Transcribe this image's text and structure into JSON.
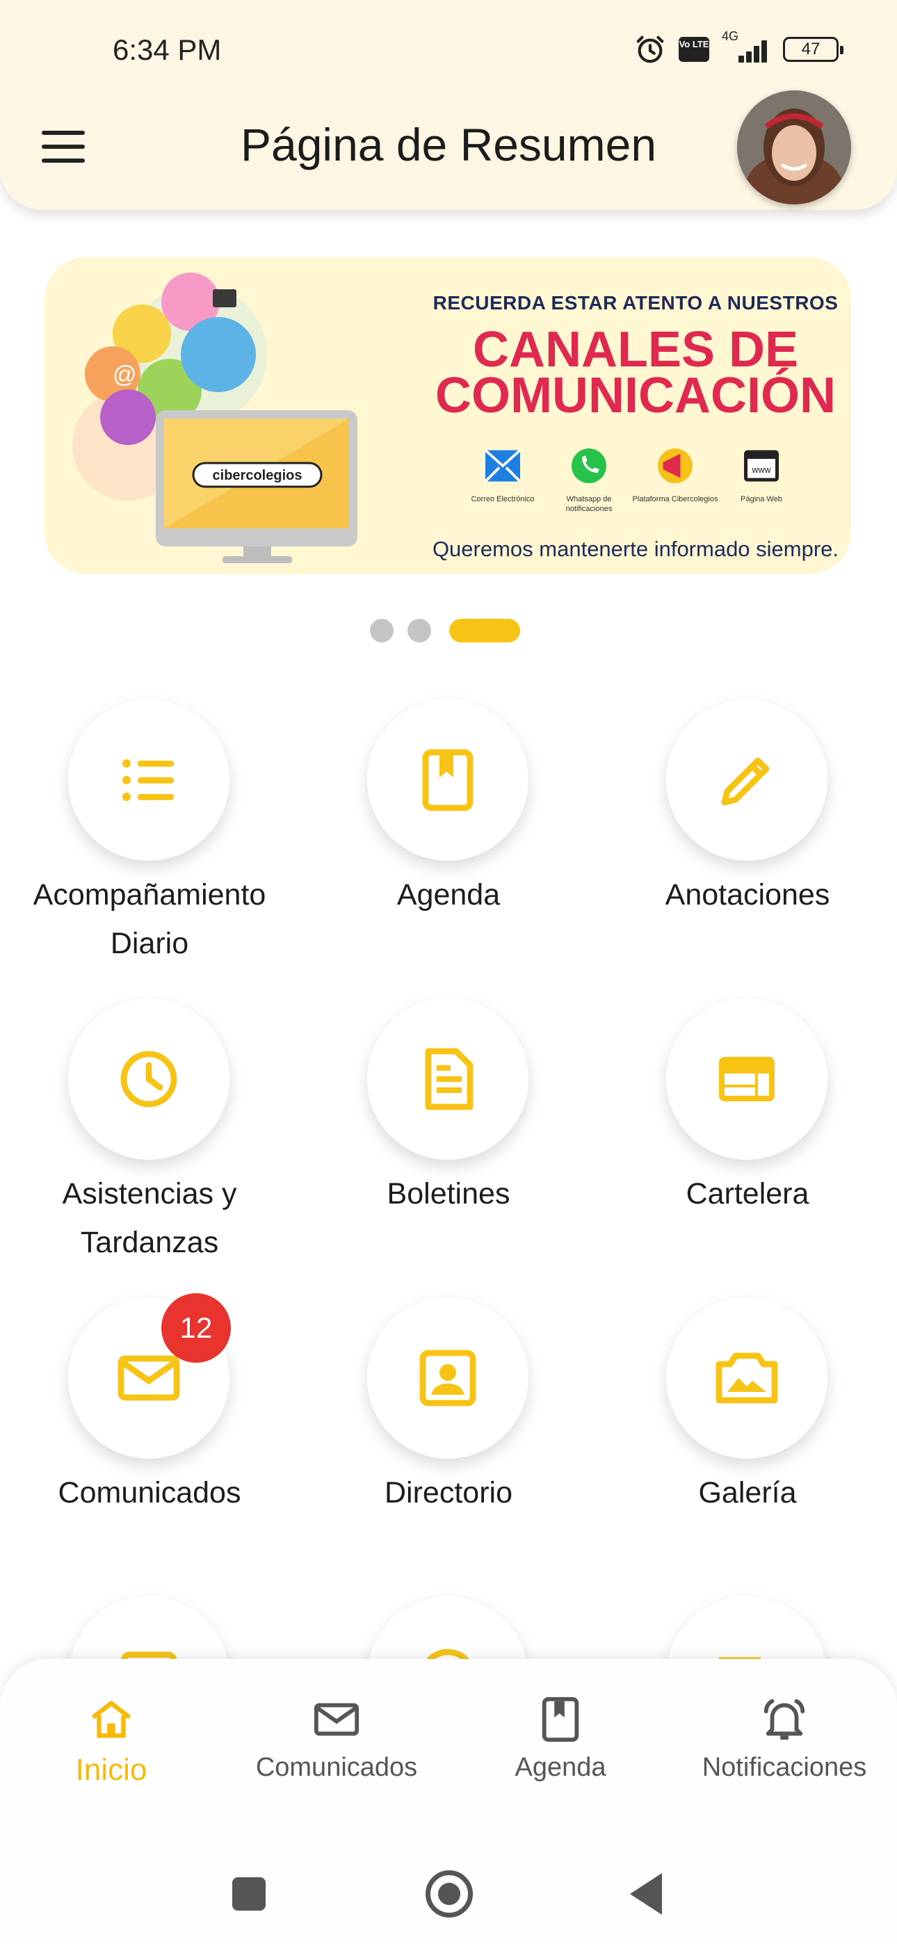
{
  "status_bar": {
    "time": "6:34 PM",
    "network": "4G",
    "volte": "Vo LTE",
    "battery": "47"
  },
  "header": {
    "title": "Página de Resumen"
  },
  "banner": {
    "line1": "RECUERDA ESTAR ATENTO A NUESTROS",
    "line2": "CANALES DE",
    "line3": "COMUNICACIÓN",
    "brand": "cibercolegios",
    "channels": [
      {
        "label": "Correo Electrónico",
        "icon": "mail-icon"
      },
      {
        "label": "Whatsapp de notificaciones",
        "icon": "whatsapp-icon"
      },
      {
        "label": "Plataforma Cibercolegios",
        "icon": "megaphone-icon"
      },
      {
        "label": "Página Web",
        "icon": "web-icon"
      }
    ],
    "footer": "Queremos mantenerte informado siempre."
  },
  "carousel": {
    "count": 3,
    "active": 3
  },
  "tiles": [
    {
      "label": "Acompañamiento Diario",
      "icon": "list-icon"
    },
    {
      "label": "Agenda",
      "icon": "bookmark-book-icon"
    },
    {
      "label": "Anotaciones",
      "icon": "pencil-icon"
    },
    {
      "label": "Asistencias y Tardanzas",
      "icon": "clock-icon"
    },
    {
      "label": "Boletines",
      "icon": "document-icon"
    },
    {
      "label": "Cartelera",
      "icon": "billboard-icon"
    },
    {
      "label": "Comunicados",
      "icon": "mail-icon",
      "badge": "12"
    },
    {
      "label": "Directorio",
      "icon": "contact-icon"
    },
    {
      "label": "Galería",
      "icon": "photo-icon"
    }
  ],
  "bottom_nav": [
    {
      "label": "Inicio",
      "icon": "home-icon",
      "active": true
    },
    {
      "label": "Comunicados",
      "icon": "mail-icon",
      "active": false
    },
    {
      "label": "Agenda",
      "icon": "bookmark-book-icon",
      "active": false
    },
    {
      "label": "Notificaciones",
      "icon": "bell-icon",
      "active": false
    }
  ],
  "colors": {
    "accent": "#f7c416",
    "header_bg": "#fdf6e3",
    "badge": "#e8332f",
    "banner_red": "#e0294f",
    "banner_navy": "#1d2a5a"
  }
}
